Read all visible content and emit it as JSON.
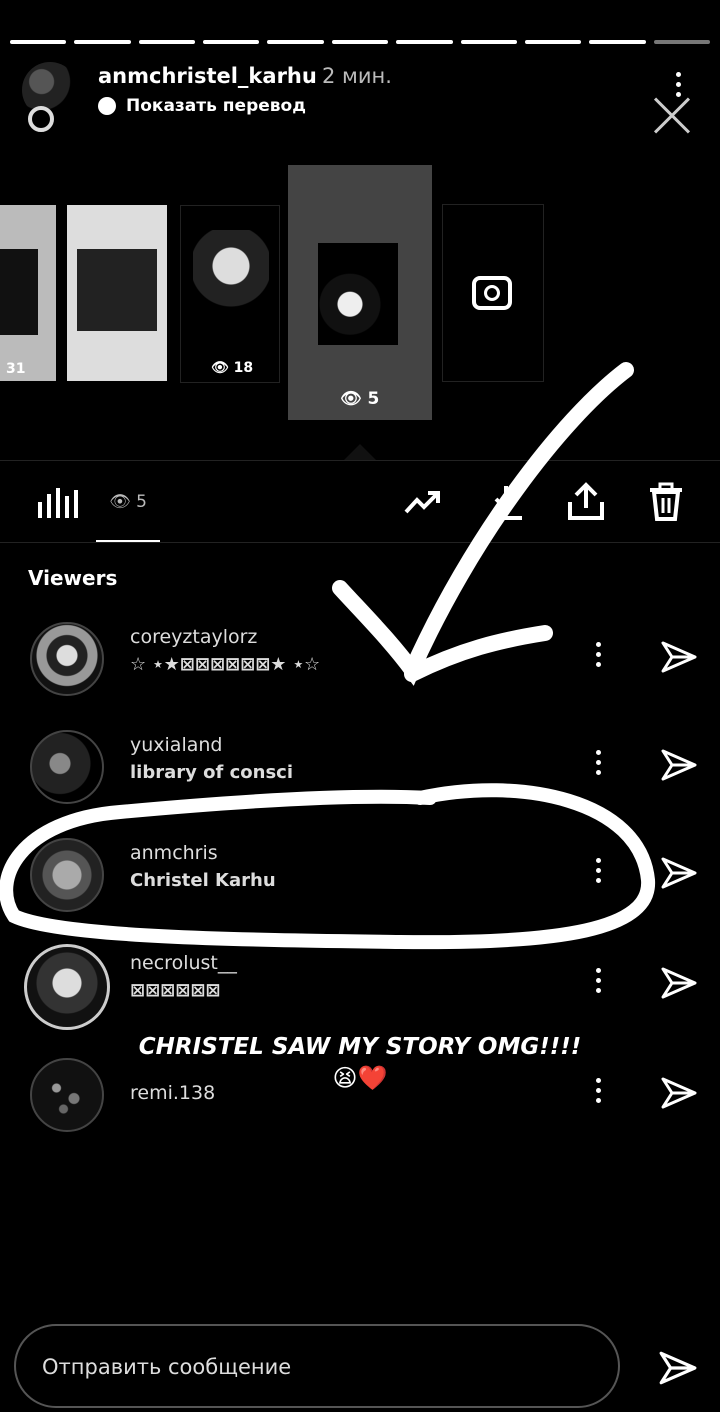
{
  "story": {
    "username": "anmchristel_karhu",
    "time": "2 мин.",
    "translate_label": "Показать перевод"
  },
  "thumbnails": [
    {
      "views": "31"
    },
    {
      "views": ""
    },
    {
      "views": "18"
    },
    {
      "views": "5"
    }
  ],
  "tabs": {
    "views_count": "5"
  },
  "viewers_title": "Viewers",
  "viewers": [
    {
      "username": "coreyztaylorz",
      "subtitle": "☆ ⋆★⊠⊠⊠⊠⊠⊠★ ⋆☆"
    },
    {
      "username": "yuxialand",
      "subtitle": "library of consci"
    },
    {
      "username": "anmchris",
      "subtitle": "Christel Karhu"
    },
    {
      "username": "necrolust__",
      "subtitle": "⊠⊠⊠⊠⊠⊠"
    },
    {
      "username": "remi.138",
      "subtitle": ""
    }
  ],
  "overlay": {
    "caption": "CHRISTEL SAW MY STORY OMG!!!!",
    "emoji": "😫❤️"
  },
  "message": {
    "placeholder": "Отправить сообщение"
  }
}
